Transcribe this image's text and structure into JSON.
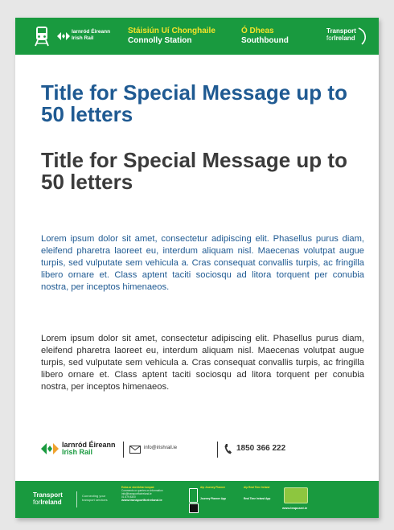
{
  "header": {
    "operator_ga": "Iarnród Éireann",
    "operator_en": "Irish Rail",
    "station_ga": "Stáisiún Uí Chonghaile",
    "station_en": "Connolly Station",
    "direction_ga": "Ó Dheas",
    "direction_en": "Southbound",
    "tfi_line1": "Transport",
    "tfi_line2_small": "for",
    "tfi_line2_bold": "Ireland"
  },
  "content": {
    "title_ga": "Title for Special Message up to 50 letters",
    "title_en": "Title for Special Message up to 50 letters",
    "body_ga": "Lorem ipsum dolor sit amet, consectetur adipiscing elit. Phasellus purus diam, eleifend pharetra laoreet eu, interdum aliquam nisl. Maecenas volutpat augue turpis, sed vulputate sem vehicula a. Cras consequat convallis turpis, ac fringilla libero ornare et. Class aptent taciti sociosqu ad litora torquent per conubia nostra, per inceptos himenaeos.",
    "body_en": "Lorem ipsum dolor sit amet, consectetur adipiscing elit. Phasellus purus diam, eleifend pharetra laoreet eu, interdum aliquam nisl. Maecenas volutpat augue turpis, sed vulputate sem vehicula a. Cras consequat convallis turpis, ac fringilla libero ornare et. Class aptent taciti sociosqu ad litora torquent per conubia nostra, per inceptos himenaeos."
  },
  "contact": {
    "name_ga": "Iarnród Éireann",
    "name_en": "Irish Rail",
    "email": "info@irishrail.ie",
    "phone": "1850 366 222"
  },
  "footer": {
    "tfi_line1": "Transport",
    "tfi_line2_small": "for",
    "tfi_line2_bold": "Ireland",
    "tagline_1": "Connecting your",
    "tagline_2": "transport services",
    "block1_head": "Eolas ar sheirbhísí iompair",
    "block1_sub": "Comments or queries on information",
    "block1_line1": "info@transportforireland.ie",
    "block1_line2": "01 879 8300",
    "block1_url": "www.transportforireland.ie",
    "block2_head": "Aip Journey Planner",
    "block2_head2": "Journey Planner App",
    "block3_head": "Aip Real Time Ireland",
    "block3_head2": "Real Time Ireland App",
    "block4_url": "www.leapcard.ie"
  },
  "colors": {
    "brand_green": "#199a3f",
    "title_blue": "#1f5a92",
    "station_yellow": "#f3e32a"
  }
}
